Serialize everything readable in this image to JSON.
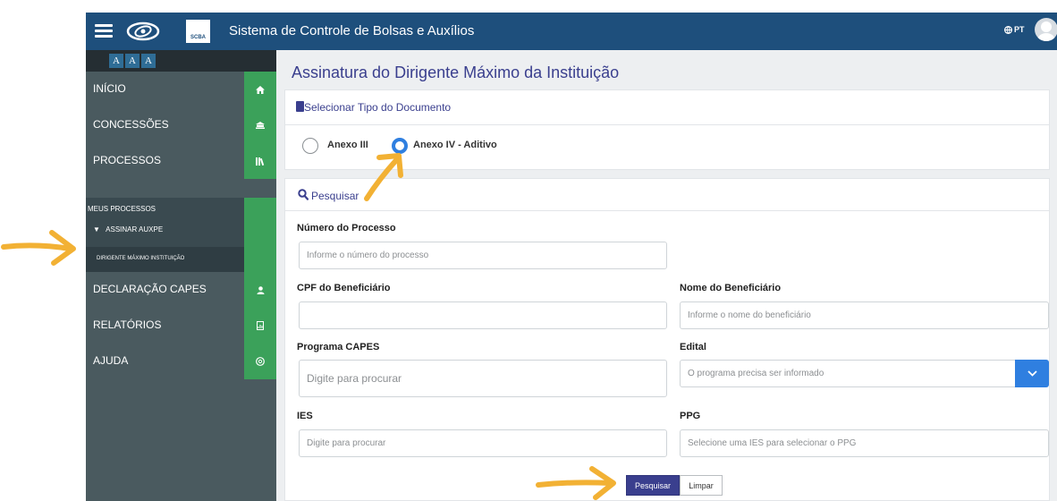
{
  "header": {
    "app_title": "Sistema de Controle de Bolsas e Auxílios",
    "scba_logo_text": "SCBA",
    "language": "PT",
    "menu_icon": "hamburger-icon",
    "user_icon": "user-avatar",
    "colors": {
      "topbar": "#1e4f7c"
    }
  },
  "accessibility": {
    "font_buttons": [
      "A",
      "A",
      "A"
    ]
  },
  "sidebar": {
    "colors": {
      "background": "#4a5a5f",
      "icon_strip": "#3ba15a"
    },
    "items": [
      {
        "label": "INÍCIO",
        "icon": "home-icon"
      },
      {
        "label": "CONCESSÕES",
        "icon": "bank-icon"
      },
      {
        "label": "PROCESSOS",
        "icon": "library-icon"
      },
      {
        "label": "DECLARAÇÃO CAPES",
        "icon": "user-icon"
      },
      {
        "label": "RELATÓRIOS",
        "icon": "report-icon"
      },
      {
        "label": "AJUDA",
        "icon": "help-icon"
      }
    ],
    "submenu": {
      "title": "MEUS PROCESSOS",
      "item": "ASSINAR AUXPE",
      "active": "DIRIGENTE MÁXIMO INSTITUIÇÃO"
    }
  },
  "page": {
    "title": "Assinatura do Dirigente Máximo da Instituição",
    "doc_type": {
      "header": "Selecionar Tipo do Documento",
      "options": [
        "Anexo III",
        "Anexo IV - Aditivo"
      ],
      "selected": "Anexo IV - Aditivo"
    },
    "search": {
      "header": "Pesquisar",
      "fields": {
        "processo": {
          "label": "Número do Processo",
          "placeholder": "Informe o número do processo",
          "value": ""
        },
        "cpf": {
          "label": "CPF do Beneficiário",
          "placeholder": "",
          "value": ""
        },
        "nome": {
          "label": "Nome do Beneficiário",
          "placeholder": "Informe o nome do beneficiário",
          "value": ""
        },
        "programa": {
          "label": "Programa CAPES",
          "placeholder": "Digite para procurar",
          "value": ""
        },
        "edital": {
          "label": "Edital",
          "placeholder": "O programa precisa ser informado",
          "value": ""
        },
        "ies": {
          "label": "IES",
          "placeholder": "Digite para procurar",
          "value": ""
        },
        "ppg": {
          "label": "PPG",
          "placeholder": "Selecione uma IES para selecionar o PPG",
          "value": ""
        }
      },
      "buttons": {
        "search": "Pesquisar",
        "clear": "Limpar"
      }
    }
  },
  "annotations": {
    "arrow_color": "#f2b134"
  }
}
